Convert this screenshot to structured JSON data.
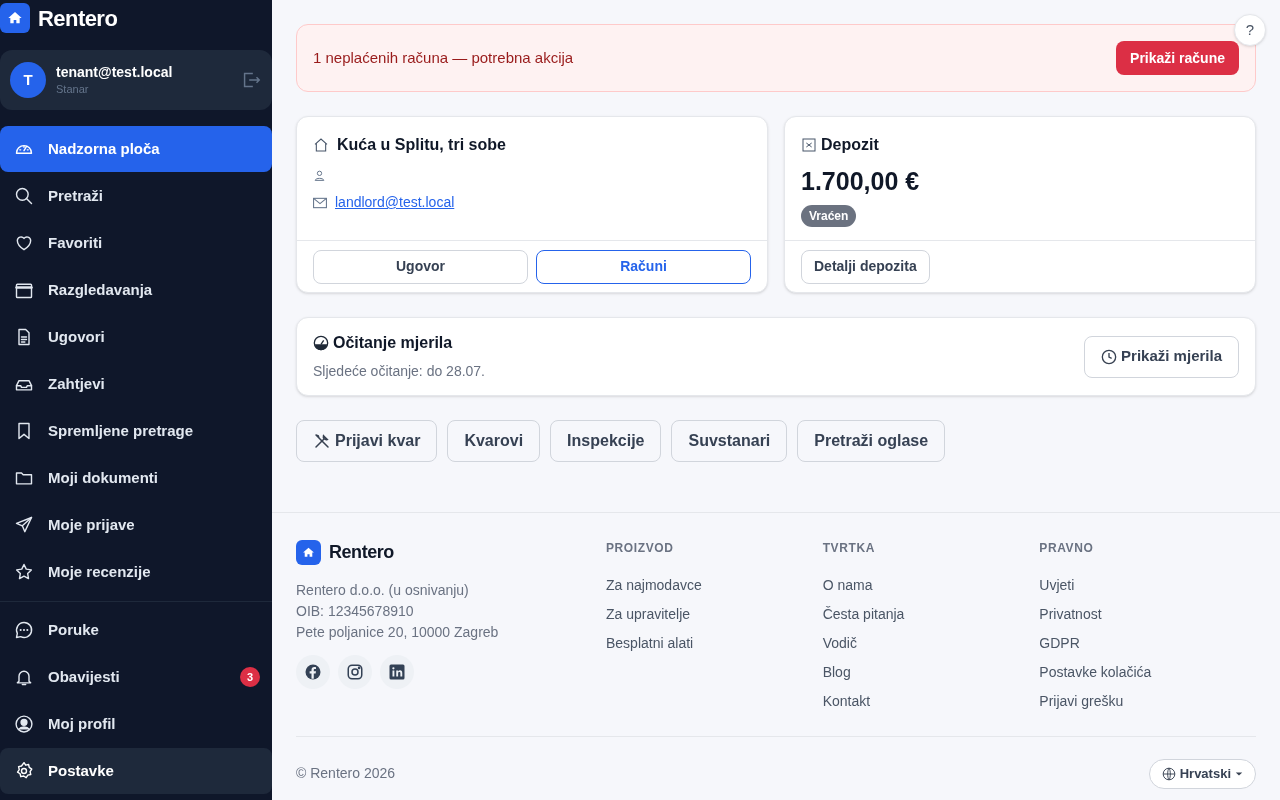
{
  "sidebar": {
    "brand": "Rentero",
    "user": {
      "avatar_letter": "T",
      "email": "tenant@test.local",
      "role": "Stanar"
    },
    "nav_groups": [
      [
        {
          "label": "Nadzorna ploča",
          "selected": true,
          "highlighted": false
        },
        {
          "label": "Pretraži",
          "selected": false,
          "highlighted": false
        },
        {
          "label": "Favoriti",
          "selected": false,
          "highlighted": false
        },
        {
          "label": "Razgledavanja",
          "selected": false,
          "highlighted": false
        },
        {
          "label": "Ugovori",
          "selected": false,
          "highlighted": false
        },
        {
          "label": "Zahtjevi",
          "selected": false,
          "highlighted": false
        },
        {
          "label": "Spremljene pretrage",
          "selected": false,
          "highlighted": false
        },
        {
          "label": "Moji dokumenti",
          "selected": false,
          "highlighted": false
        },
        {
          "label": "Moje prijave",
          "selected": false,
          "highlighted": false
        },
        {
          "label": "Moje recenzije",
          "selected": false,
          "highlighted": false
        }
      ],
      [
        {
          "label": "Poruke",
          "selected": false,
          "highlighted": false
        },
        {
          "label": "Obavijesti",
          "selected": false,
          "highlighted": false,
          "badge": "3"
        },
        {
          "label": "Moj profil",
          "selected": false,
          "highlighted": false
        },
        {
          "label": "Postavke",
          "selected": false,
          "highlighted": true
        }
      ]
    ]
  },
  "help_button": "?",
  "alert": {
    "message": "1 neplaćenih računa — potrebna akcija",
    "button": "Prikaži račune"
  },
  "property_card": {
    "title": "Kuća u Splitu, tri sobe",
    "email": "landlord@test.local",
    "buttons": [
      {
        "label": "Ugovor",
        "selected": false
      },
      {
        "label": "Računi",
        "selected": true
      }
    ]
  },
  "deposit_card": {
    "title": "Depozit",
    "amount": "1.700,00 €",
    "status": "Vraćen",
    "button": "Detalji depozita"
  },
  "meter_card": {
    "title": "Očitanje mjerila",
    "subtitle": "Sljedeće očitanje: do 28.07.",
    "button": "Prikaži mjerila"
  },
  "actions": [
    {
      "label": "Prijavi kvar",
      "kind": "icon"
    },
    {
      "label": "Kvarovi",
      "kind": "plain"
    },
    {
      "label": "Inspekcije",
      "kind": "plain"
    },
    {
      "label": "Suvstanari",
      "kind": "plain"
    },
    {
      "label": "Pretraži oglase",
      "kind": "plain"
    }
  ],
  "footer": {
    "brand": "Rentero",
    "company_lines": [
      "Rentero d.o.o. (u osnivanju)",
      "OIB: 12345678910",
      "Pete poljanice 20, 10000 Zagreb"
    ],
    "columns": [
      {
        "heading": "PROIZVOD",
        "links": [
          "Za najmodavce",
          "Za upravitelje",
          "Besplatni alati"
        ]
      },
      {
        "heading": "TVRTKA",
        "links": [
          "O nama",
          "Česta pitanja",
          "Vodič",
          "Blog",
          "Kontakt"
        ]
      },
      {
        "heading": "PRAVNO",
        "links": [
          "Uvjeti",
          "Privatnost",
          "GDPR",
          "Postavke kolačića",
          "Prijavi grešku"
        ]
      }
    ],
    "copyright": "© Rentero 2026",
    "language": "Hrvatski"
  }
}
